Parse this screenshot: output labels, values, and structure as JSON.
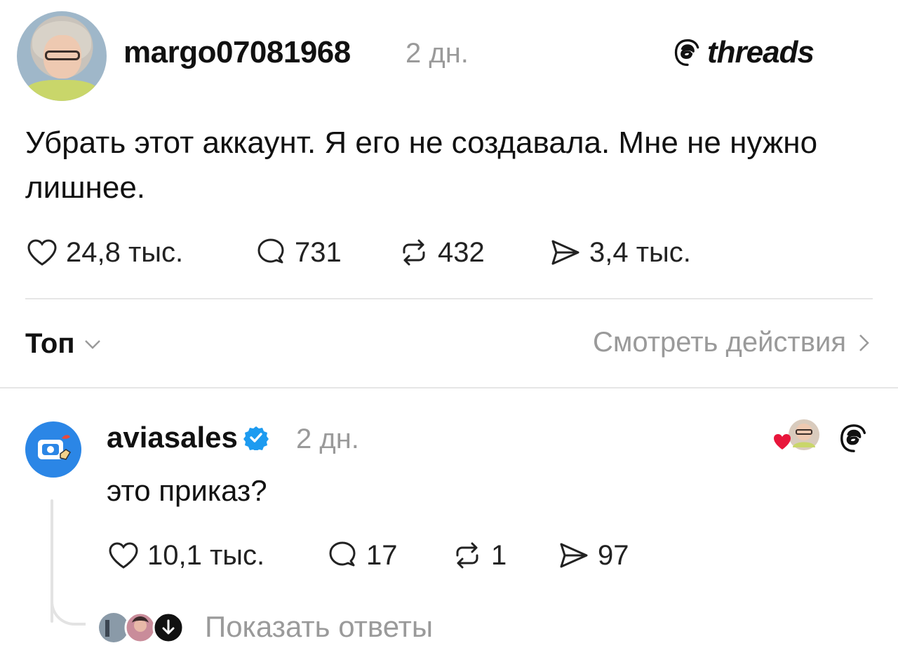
{
  "post": {
    "username": "margo07081968",
    "time": "2 дн.",
    "text": "Убрать этот аккаунт. Я его не создавала. Мне не нужно лишнее.",
    "likes": "24,8 тыс.",
    "comments": "731",
    "reposts": "432",
    "shares": "3,4 тыс."
  },
  "brand": {
    "name": "threads"
  },
  "sort": {
    "label": "Топ"
  },
  "actions": {
    "label": "Смотреть действия"
  },
  "reply": {
    "username": "aviasales",
    "time": "2 дн.",
    "text": "это приказ?",
    "likes": "10,1 тыс.",
    "comments": "17",
    "reposts": "1",
    "shares": "97",
    "verified_color": "#1d9bf0"
  },
  "show_replies": {
    "label": "Показать ответы"
  },
  "colors": {
    "muted": "#9a9a9a",
    "divider": "#e6e6e6",
    "heart": "#e8163b",
    "aviasales_blue": "#2b86e6"
  }
}
